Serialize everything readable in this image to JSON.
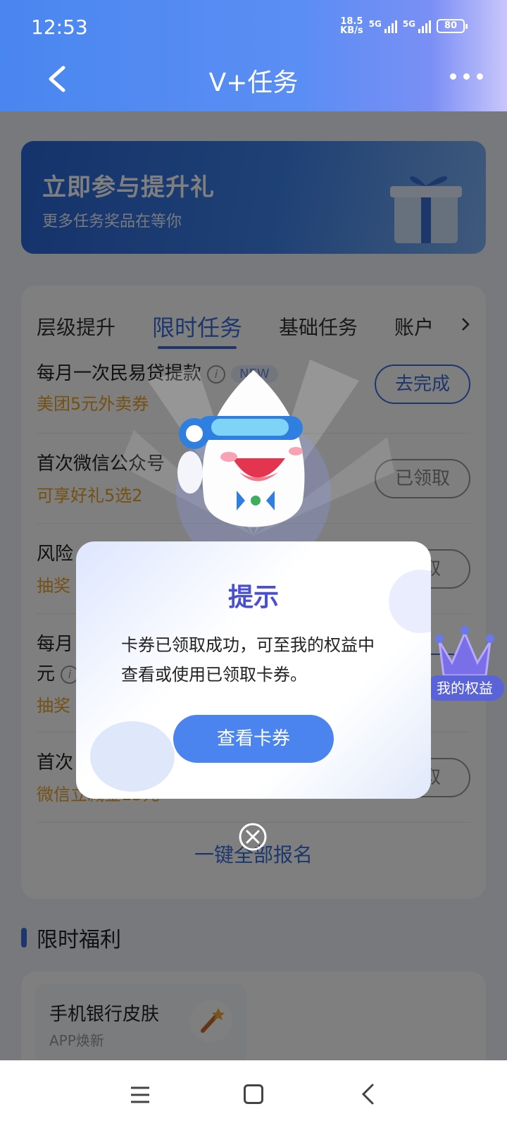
{
  "status_bar": {
    "time": "12:53",
    "net_speed_value": "18.5",
    "net_speed_unit": "KB/s",
    "signal1_label": "5G",
    "signal2_label": "5G",
    "battery": "80"
  },
  "header": {
    "title": "V+任务"
  },
  "banner": {
    "title": "立即参与提升礼",
    "subtitle": "更多任务奖品在等你"
  },
  "tabs": [
    {
      "label": "层级提升"
    },
    {
      "label": "限时任务"
    },
    {
      "label": "基础任务"
    },
    {
      "label": "账户"
    }
  ],
  "tasks": [
    {
      "title": "每月一次民易贷提款",
      "reward": "美团5元外卖券",
      "badge": "NEW",
      "button": "去完成"
    },
    {
      "title": "首次微信公众号",
      "reward": "可享好礼5选2",
      "button": "已领取"
    },
    {
      "title": "风险",
      "reward": "抽奖",
      "button": "领取"
    },
    {
      "title_line1": "每月",
      "title_line2": "元",
      "reward": "抽奖",
      "button": "成"
    },
    {
      "title": "首次",
      "reward": "微信立减金15元",
      "button": "领取"
    }
  ],
  "signup_all": "一键全部报名",
  "section": {
    "title": "限时福利"
  },
  "benefit": {
    "title": "手机银行皮肤",
    "subtitle": "APP焕新"
  },
  "floating_badge": {
    "label": "我的权益"
  },
  "dialog": {
    "title": "提示",
    "message": "卡券已领取成功，可至我的权益中查看或使用已领取卡券。",
    "button": "查看卡券"
  },
  "colors": {
    "accent": "#3a6fd8",
    "reward": "#e8a12a",
    "dialog_title": "#4a4fd0",
    "dialog_button": "#4b84ee"
  }
}
